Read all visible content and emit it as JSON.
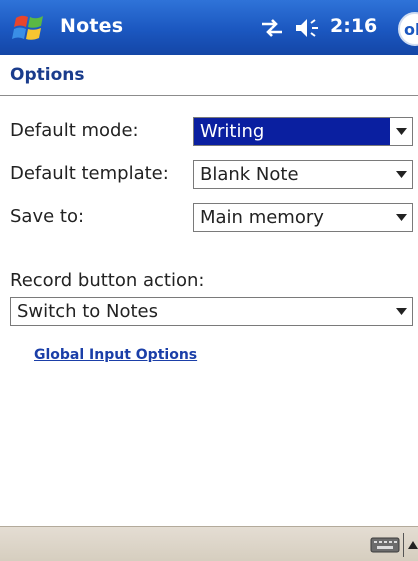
{
  "titlebar": {
    "app_title": "Notes",
    "time": "2:16",
    "ok_label": "ok",
    "icons": [
      "windows-start-icon",
      "connectivity-icon",
      "volume-icon"
    ]
  },
  "header": {
    "title": "Options"
  },
  "form": {
    "default_mode": {
      "label": "Default mode:",
      "value": "Writing"
    },
    "default_template": {
      "label": "Default template:",
      "value": "Blank Note"
    },
    "save_to": {
      "label": "Save to:",
      "value": "Main memory"
    },
    "record_button_action": {
      "label": "Record button action:",
      "value": "Switch to Notes"
    }
  },
  "link": {
    "label": "Global Input Options"
  },
  "menubar": {
    "icons": [
      "keyboard-icon",
      "sip-arrow-icon"
    ]
  },
  "colors": {
    "titlebar": "#1b57c0",
    "selection": "#0a1fa0",
    "link": "#1b3fa8",
    "menubar": "#d6cebf"
  }
}
